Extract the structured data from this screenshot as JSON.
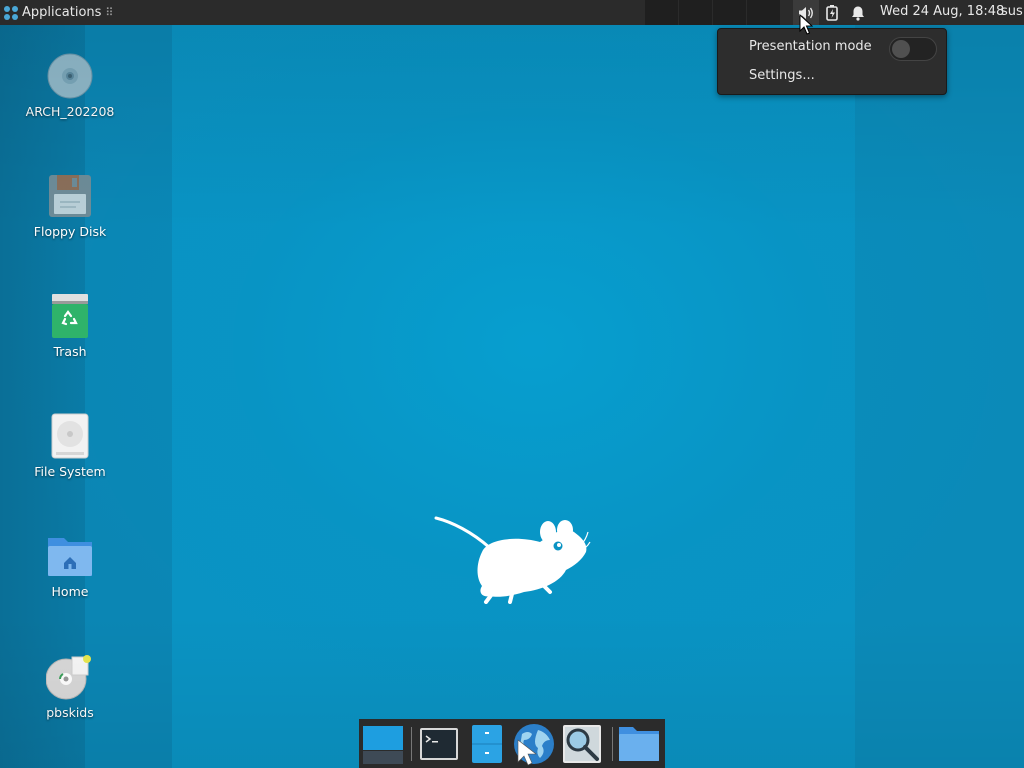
{
  "top_panel": {
    "applications_label": "Applications",
    "applications_dots": "⠿",
    "clock": "Wed 24 Aug, 18:48",
    "user": "sus"
  },
  "popup": {
    "presentation_mode_label": "Presentation mode",
    "presentation_mode_on": false,
    "settings_label": "Settings..."
  },
  "desktop_icons": [
    {
      "label": "ARCH_202208",
      "icon": "optical-disc-icon"
    },
    {
      "label": "Floppy Disk",
      "icon": "floppy-disk-icon"
    },
    {
      "label": "Trash",
      "icon": "trash-icon"
    },
    {
      "label": "File System",
      "icon": "hard-drive-icon"
    },
    {
      "label": "Home",
      "icon": "home-folder-icon"
    },
    {
      "label": "pbskids",
      "icon": "disc-file-icon"
    }
  ],
  "dock_items": [
    {
      "name": "show-desktop",
      "icon": "show-desktop-icon"
    },
    {
      "name": "terminal",
      "icon": "terminal-icon"
    },
    {
      "name": "file-manager",
      "icon": "file-manager-icon"
    },
    {
      "name": "web-browser",
      "icon": "web-browser-icon"
    },
    {
      "name": "app-finder",
      "icon": "magnifier-icon"
    },
    {
      "name": "home-folder",
      "icon": "folder-icon"
    }
  ],
  "colors": {
    "panel_bg": "#2b2b2b",
    "desktop_bg": "#0a93c3",
    "popup_bg": "#2d2d2d"
  }
}
